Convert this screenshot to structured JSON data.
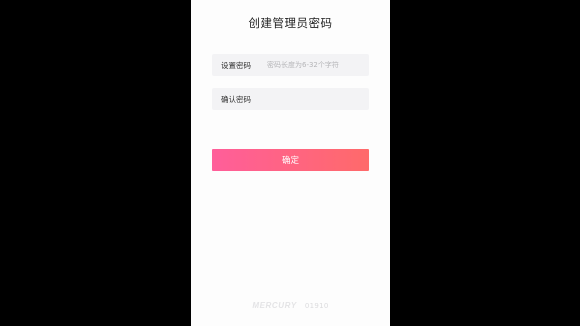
{
  "page": {
    "title": "创建管理员密码"
  },
  "form": {
    "password": {
      "label": "设置密码",
      "placeholder": "密码长度为6-32个字符",
      "value": ""
    },
    "confirm": {
      "label": "确认密码",
      "placeholder": "",
      "value": ""
    },
    "submit_label": "确定"
  },
  "footer": {
    "brand": "MERCURY",
    "code": "01910"
  },
  "colors": {
    "button_gradient_start": "#ff5e9a",
    "button_gradient_end": "#ff6a6a",
    "field_background": "#f3f3f5",
    "background": "#fdfdfd"
  }
}
